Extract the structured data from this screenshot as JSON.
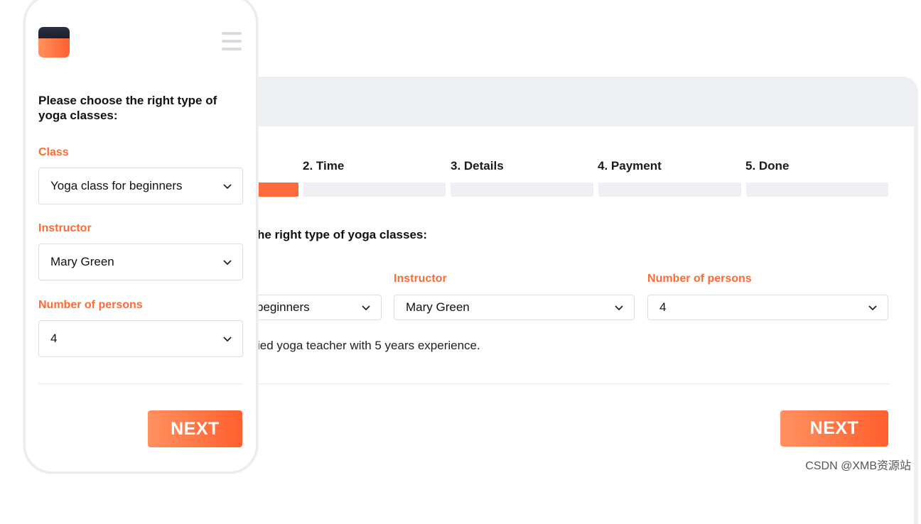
{
  "desktop": {
    "steps": [
      {
        "label": "2. Time"
      },
      {
        "label": "3. Details"
      },
      {
        "label": "4. Payment"
      },
      {
        "label": "5. Done"
      }
    ],
    "progress_fraction": 0.2,
    "question": "he right type of yoga classes:",
    "fields": {
      "class_value": "beginners",
      "instructor_label": "Instructor",
      "instructor_value": "Mary Green",
      "persons_label": "Number of persons",
      "persons_value": "4"
    },
    "description": "ied yoga teacher with 5 years experience.",
    "next_label": "NEXT"
  },
  "mobile": {
    "question": "Please choose the right type of yoga classes:",
    "class_label": "Class",
    "class_value": "Yoga class for beginners",
    "instructor_label": "Instructor",
    "instructor_value": "Mary Green",
    "persons_label": "Number of persons",
    "persons_value": "4",
    "next_label": "NEXT"
  },
  "watermark": "CSDN @XMB资源站",
  "colors": {
    "accent": "#ff6a3d",
    "label": "#ff6a33",
    "bar": "#eff0f4",
    "dark": "#1c2030"
  },
  "icons": [
    "chevron-down-icon",
    "hamburger-menu-icon",
    "logo-icon"
  ]
}
